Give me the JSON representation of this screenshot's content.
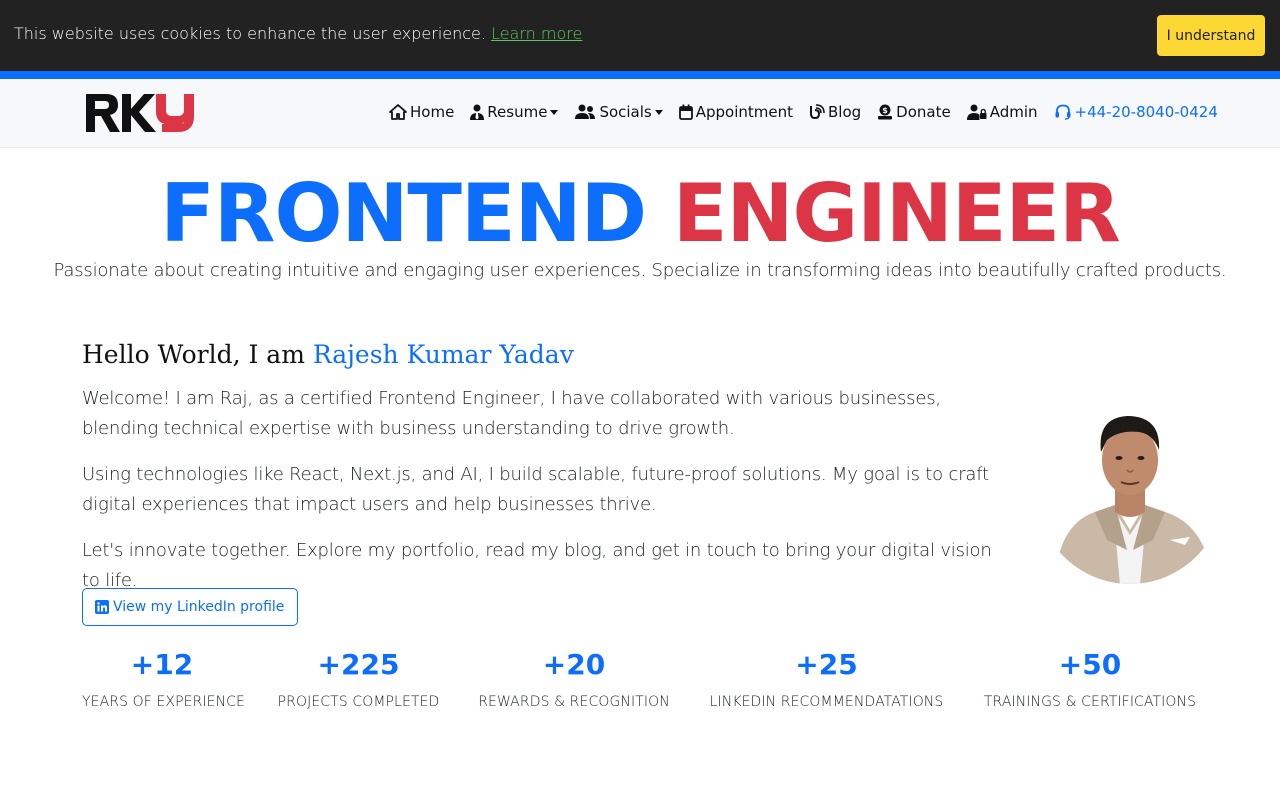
{
  "cookie": {
    "text": "This website uses cookies to enhance the user experience.",
    "link": "Learn more",
    "button": "I understand"
  },
  "nav": {
    "logo_text": "RKY",
    "items": [
      {
        "label": "Home",
        "icon": "home-icon"
      },
      {
        "label": "Resume",
        "icon": "user-tie-icon",
        "dropdown": true
      },
      {
        "label": "Socials",
        "icon": "users-icon",
        "dropdown": true
      },
      {
        "label": "Appointment",
        "icon": "calendar-icon"
      },
      {
        "label": "Blog",
        "icon": "blog-icon"
      },
      {
        "label": "Donate",
        "icon": "donate-icon"
      },
      {
        "label": "Admin",
        "icon": "user-lock-icon"
      },
      {
        "label": "+44-20-8040-0424",
        "icon": "headset-icon"
      }
    ]
  },
  "hero": {
    "title_part1": "FRONTEND",
    "title_part2": "ENGINEER",
    "subtitle": "Passionate about creating intuitive and engaging user experiences. Specialize in transforming ideas into beautifully crafted products."
  },
  "intro": {
    "greeting": "Hello World, I am",
    "name": "Rajesh Kumar Yadav",
    "p1": "Welcome! I am Raj, as a certified Frontend Engineer, I have collaborated with various businesses, blending technical expertise with business understanding to drive growth.",
    "p2": "Using technologies like React, Next.js, and AI, I build scalable, future-proof solutions. My goal is to craft digital experiences that impact users and help businesses thrive.",
    "p3": "Let's innovate together. Explore my portfolio, read my blog, and get in touch to bring your digital vision to life.",
    "linkedin_button": "View my LinkedIn profile"
  },
  "stats": [
    {
      "value": "+12",
      "label": "YEARS OF EXPERIENCE"
    },
    {
      "value": "+225",
      "label": "PROJECTS COMPLETED"
    },
    {
      "value": "+20",
      "label": "REWARDS & RECOGNITION"
    },
    {
      "value": "+25",
      "label": "LINKEDIN RECOMMENDATATIONS"
    },
    {
      "value": "+50",
      "label": "TRAININGS & CERTIFICATIONS"
    }
  ],
  "colors": {
    "primary": "#0d6efd",
    "danger": "#dc3545",
    "cookie_bg": "#222222",
    "cookie_button": "#fdd734",
    "cookie_link": "#5ac85a"
  }
}
